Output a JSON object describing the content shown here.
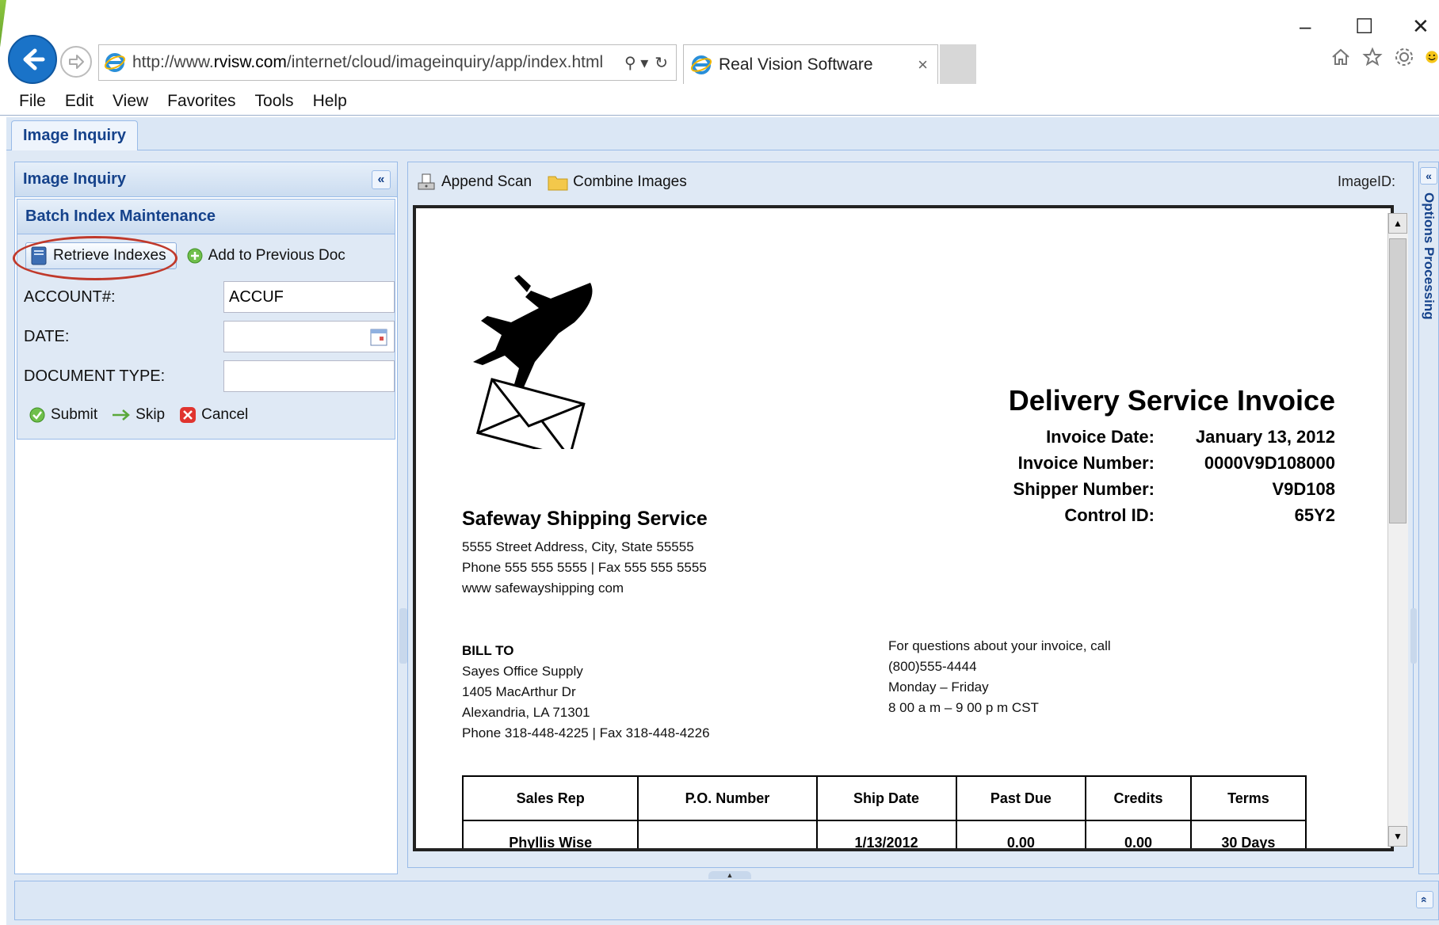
{
  "browser": {
    "url_prefix": "http://www.",
    "url_domain": "rvisw.com",
    "url_path": "/internet/cloud/imageinquiry/app/index.html",
    "search_glyph": "⚲ ▾",
    "refresh_glyph": "↻",
    "tab_title": "Real Vision Software",
    "tab_close": "×",
    "minimize": "–",
    "maximize": "☐",
    "close": "✕",
    "menu": [
      "File",
      "Edit",
      "View",
      "Favorites",
      "Tools",
      "Help"
    ]
  },
  "app": {
    "tab_label": "Image Inquiry",
    "left_panel": {
      "title": "Image Inquiry",
      "collapse_glyph": "«",
      "section_title": "Batch Index Maintenance",
      "retrieve_label": "Retrieve Indexes",
      "add_prev_label": "Add to Previous Doc",
      "fields": [
        {
          "label": "ACCOUNT#:",
          "value": "ACCUF"
        },
        {
          "label": "DATE:",
          "value": ""
        },
        {
          "label": "DOCUMENT TYPE:",
          "value": ""
        }
      ],
      "submit_label": "Submit",
      "skip_label": "Skip",
      "cancel_label": "Cancel"
    },
    "viewer": {
      "append_scan_label": "Append Scan",
      "combine_images_label": "Combine Images",
      "imageid_label": "ImageID:"
    },
    "right_panel": {
      "expand_glyph": "«",
      "label": "Options Processing"
    },
    "bottom_panel": {
      "expand_glyph": "«"
    }
  },
  "document": {
    "title": "Delivery Service Invoice",
    "meta": [
      {
        "label": "Invoice Date:",
        "value": "January 13, 2012"
      },
      {
        "label": "Invoice Number:",
        "value": "0000V9D108000"
      },
      {
        "label": "Shipper Number:",
        "value": "V9D108"
      },
      {
        "label": "Control ID:",
        "value": "65Y2"
      }
    ],
    "company": {
      "name": "Safeway Shipping Service",
      "address": "5555 Street Address, City, State 55555",
      "phone_fax": "Phone  555 555 5555  |  Fax  555 555 5555",
      "web": "www safewayshipping com"
    },
    "bill_to": {
      "heading": "BILL TO",
      "lines": [
        "Sayes Office Supply",
        "1405 MacArthur Dr",
        "Alexandria, LA  71301",
        "Phone  318-448-4225  |  Fax  318-448-4226"
      ]
    },
    "questions": [
      "For questions about your invoice, call",
      "(800)555-4444",
      "Monday – Friday",
      "8 00 a m  – 9 00 p m   CST"
    ],
    "table": {
      "headers": [
        "Sales Rep",
        "P.O. Number",
        "Ship Date",
        "Past Due",
        "Credits",
        "Terms"
      ],
      "row": [
        "Phyllis Wise",
        "",
        "1/13/2012",
        "0.00",
        "0.00",
        "30 Days"
      ]
    }
  },
  "colors": {
    "panel_header_text": "#15428b",
    "panel_border": "#99bbe8",
    "panel_bg": "#dfe9f5",
    "annotation_ring": "#c0392b",
    "ie_blue": "#1a73c8"
  },
  "icons": {
    "back": "back-arrow-icon",
    "forward": "forward-arrow-icon",
    "ie": "ie-logo-icon",
    "home": "home-icon",
    "favorites": "star-icon",
    "settings": "gear-icon",
    "feedback": "smiley-icon",
    "retrieve": "book-icon",
    "add": "plus-circle-icon",
    "calendar": "calendar-icon",
    "submit": "check-circle-icon",
    "skip": "arrow-right-icon",
    "cancel": "x-circle-icon",
    "append_scan": "scanner-icon",
    "combine": "folder-icon",
    "logo": "plane-envelope-logo"
  }
}
